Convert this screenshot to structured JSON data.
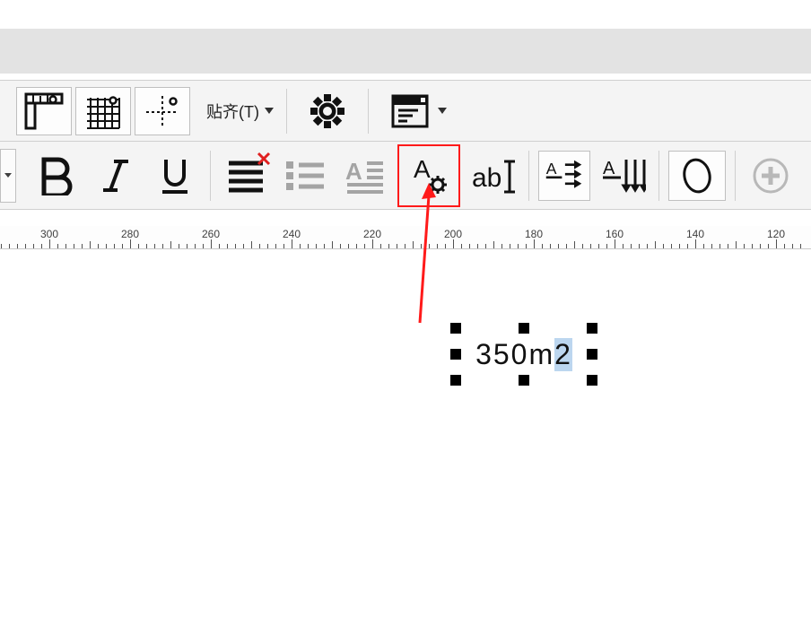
{
  "toolbar1": {
    "snap_label": "贴齐(T)"
  },
  "ruler": {
    "labels": [
      "300",
      "280",
      "260",
      "240",
      "220",
      "200",
      "180",
      "160",
      "140",
      "120"
    ]
  },
  "canvas": {
    "text_value_part1": "350m",
    "text_value_selchar": "2"
  }
}
